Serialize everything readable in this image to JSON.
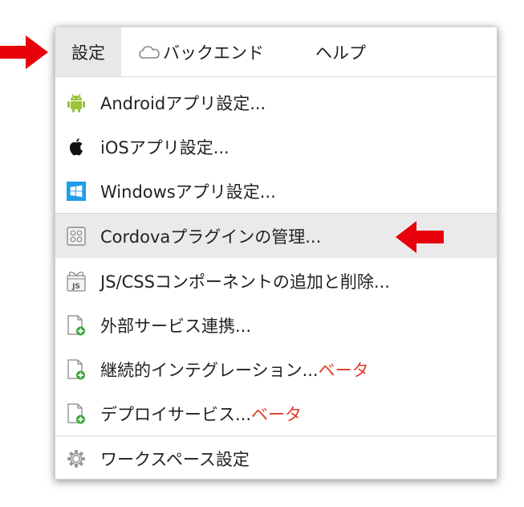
{
  "menubar": {
    "settings": "設定",
    "backend": "バックエンド",
    "help": "ヘルプ"
  },
  "menu": {
    "android": "Androidアプリ設定...",
    "ios": "iOSアプリ設定...",
    "windows": "Windowsアプリ設定...",
    "cordova": "Cordovaプラグインの管理...",
    "jscss": "JS/CSSコンポーネントの追加と削除...",
    "external": "外部サービス連携...",
    "ci": "継続的インテグレーション...",
    "ci_beta": "ベータ",
    "deploy": "デプロイサービス...",
    "deploy_beta": "ベータ",
    "workspace": "ワークスペース設定"
  },
  "icons": {
    "android": "android-icon",
    "apple": "apple-icon",
    "windows": "windows-icon",
    "cordova": "plugin-grid-icon",
    "js": "js-package-icon",
    "document_add": "document-add-icon",
    "gear": "gear-icon",
    "cloud": "cloud-icon",
    "arrow": "red-arrow-icon"
  },
  "colors": {
    "beta": "#e03b2a",
    "arrow": "#e8000b",
    "android": "#9cc23a",
    "windows": "#1e9ee8",
    "highlight": "#eaeaea"
  }
}
